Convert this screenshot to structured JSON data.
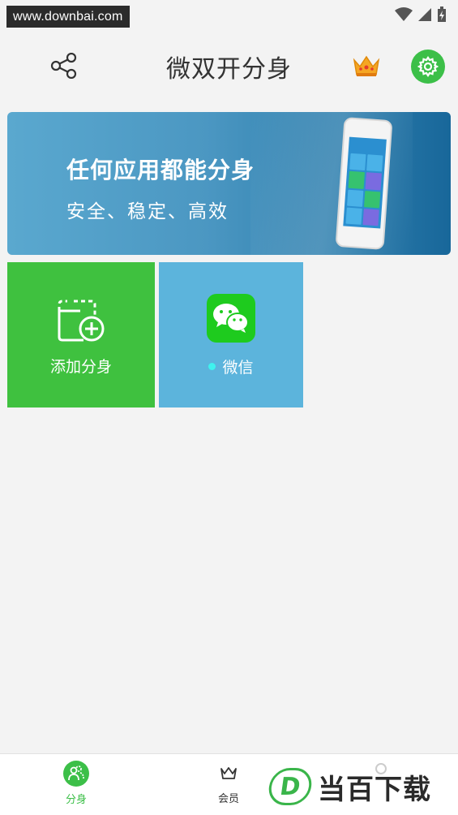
{
  "status_bar": {
    "watermark": "www.downbai.com"
  },
  "header": {
    "title": "微双开分身"
  },
  "banner": {
    "title": "任何应用都能分身",
    "subtitle": "安全、稳定、高效"
  },
  "tiles": [
    {
      "label": "添加分身",
      "icon": "add-clone-icon",
      "color": "#3fc13f"
    },
    {
      "label": "微信",
      "icon": "wechat-icon",
      "color": "#5cb4dc",
      "status_dot_color": "#3ff2ee"
    }
  ],
  "bottom_nav": {
    "items": [
      {
        "label": "分身",
        "icon": "clone-user-icon",
        "active": true
      },
      {
        "label": "会员",
        "icon": "crown-icon",
        "active": false
      }
    ],
    "accent": "#3cbf48"
  },
  "watermark_bottom": {
    "logo": "D",
    "text": "当百下载"
  }
}
